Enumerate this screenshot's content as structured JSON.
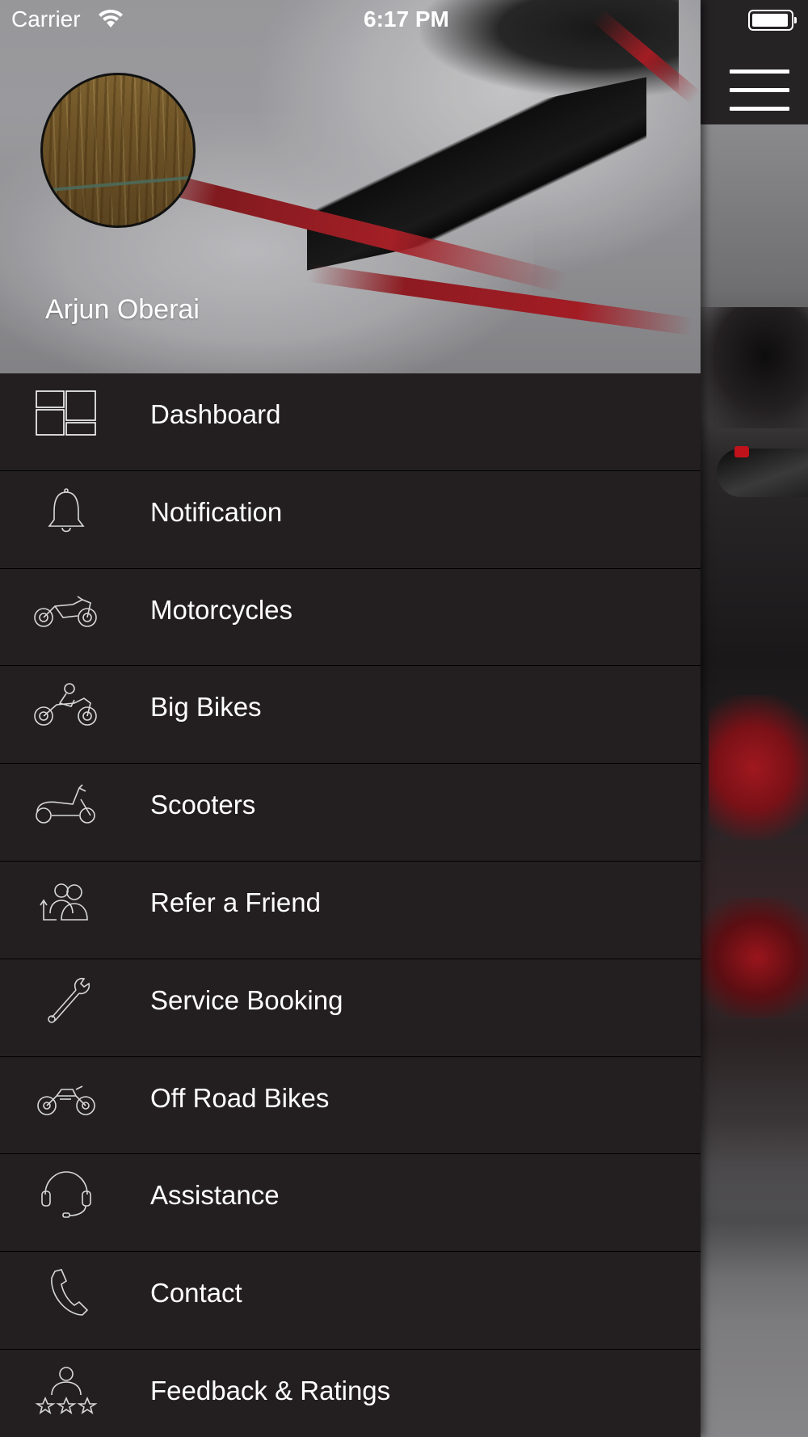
{
  "status_bar": {
    "carrier": "Carrier",
    "time": "6:17 PM"
  },
  "drawer": {
    "user_name": "Arjun Oberai",
    "menu_items": [
      {
        "label": "Dashboard",
        "icon": "dashboard-icon"
      },
      {
        "label": "Notification",
        "icon": "bell-icon"
      },
      {
        "label": "Motorcycles",
        "icon": "motorcycle-icon"
      },
      {
        "label": "Big Bikes",
        "icon": "big-bike-icon"
      },
      {
        "label": "Scooters",
        "icon": "scooter-icon"
      },
      {
        "label": "Refer a Friend",
        "icon": "refer-friend-icon"
      },
      {
        "label": "Service Booking",
        "icon": "wrench-icon"
      },
      {
        "label": "Off Road Bikes",
        "icon": "off-road-bike-icon"
      },
      {
        "label": "Assistance",
        "icon": "headset-icon"
      },
      {
        "label": "Contact",
        "icon": "phone-icon"
      },
      {
        "label": "Feedback & Ratings",
        "icon": "feedback-rating-icon"
      }
    ]
  },
  "colors": {
    "drawer_bg": "#231f20",
    "separator": "#000000",
    "text": "#ffffff"
  }
}
